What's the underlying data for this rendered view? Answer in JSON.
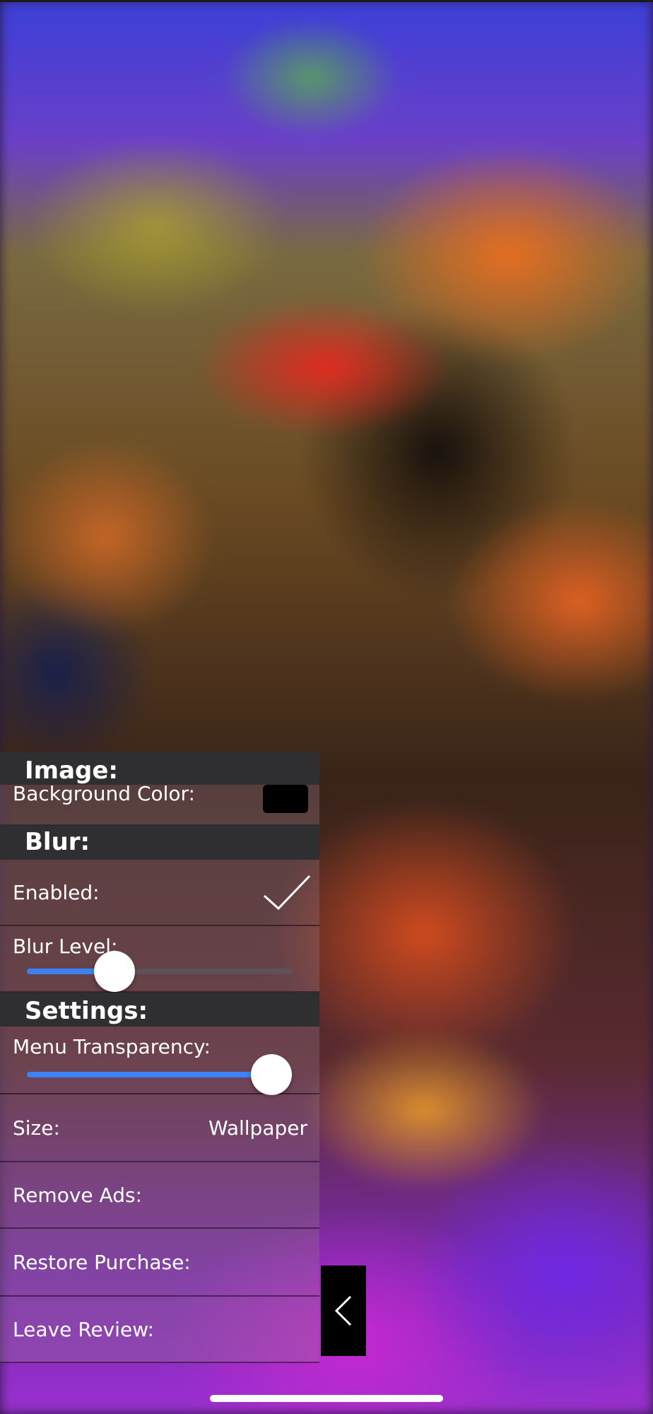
{
  "panel": {
    "image_section": {
      "header": "Image:",
      "background_color_label": "Background Color:",
      "background_color": "#000000"
    },
    "blur_section": {
      "header": "Blur:",
      "enabled_label": "Enabled:",
      "enabled": true,
      "blur_level_label": "Blur Level:",
      "blur_level_fraction": 0.33
    },
    "settings_section": {
      "header": "Settings:",
      "menu_transparency_label": "Menu Transparency:",
      "menu_transparency_fraction": 0.92,
      "size_label": "Size:",
      "size_value": "Wallpaper",
      "remove_ads_label": "Remove Ads:",
      "restore_purchase_label": "Restore Purchase:",
      "leave_review_label": "Leave Review:"
    }
  },
  "colors": {
    "section_header_bg": "#2f2f31",
    "slider_accent": "#3b82f6"
  },
  "back_tab": {
    "icon": "chevron-left-icon"
  }
}
